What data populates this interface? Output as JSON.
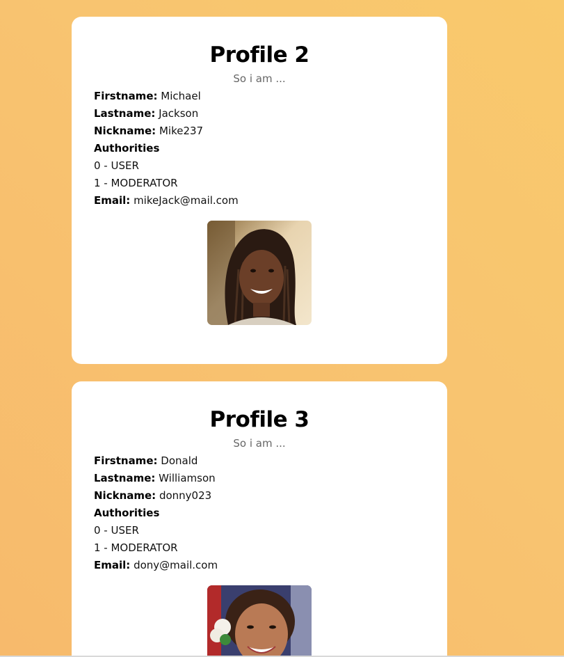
{
  "profiles": [
    {
      "title": "Profile 2",
      "subtitle": "So i am ...",
      "firstname_label": "Firstname:",
      "firstname": "Michael",
      "lastname_label": "Lastname:",
      "lastname": "Jackson",
      "nickname_label": "Nickname:",
      "nickname": "Mike237",
      "authorities_label": "Authorities",
      "authorities": [
        "0 - USER",
        "1 - MODERATOR"
      ],
      "email_label": "Email:",
      "email": "mikeJack@mail.com"
    },
    {
      "title": "Profile 3",
      "subtitle": "So i am ...",
      "firstname_label": "Firstname:",
      "firstname": "Donald",
      "lastname_label": "Lastname:",
      "lastname": "Williamson",
      "nickname_label": "Nickname:",
      "nickname": "donny023",
      "authorities_label": "Authorities",
      "authorities": [
        "0 - USER",
        "1 - MODERATOR"
      ],
      "email_label": "Email:",
      "email": "dony@mail.com"
    }
  ]
}
